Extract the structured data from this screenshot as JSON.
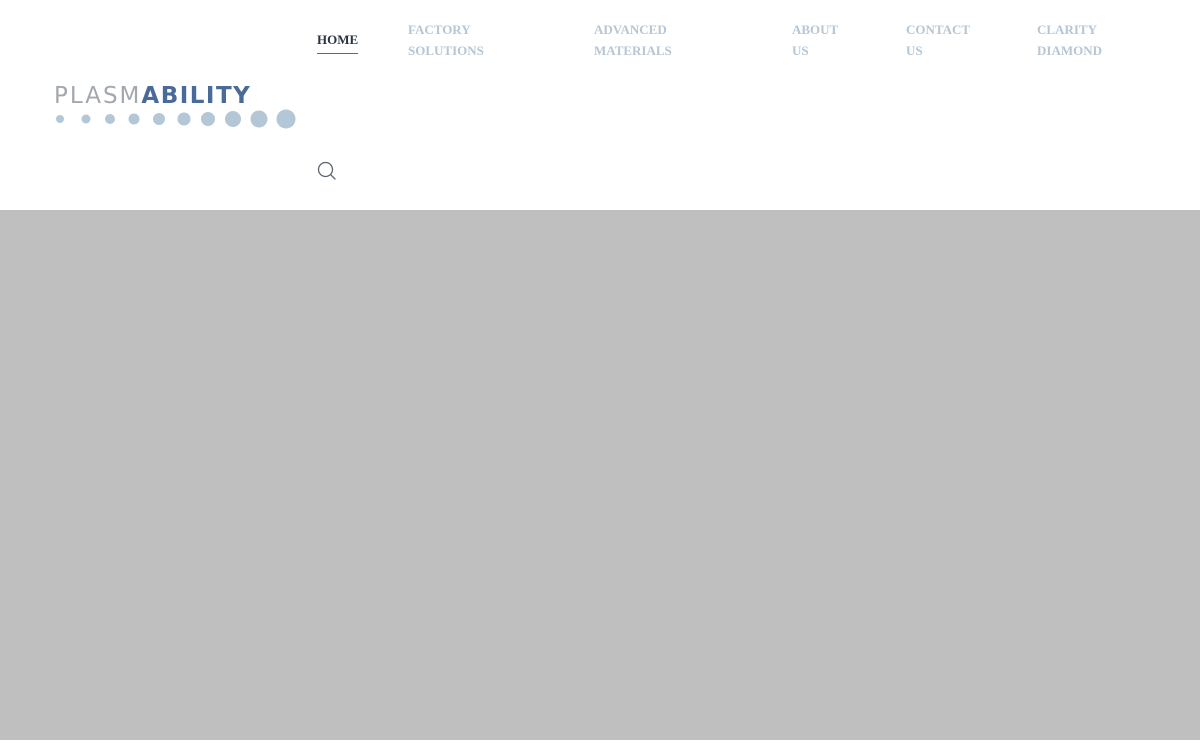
{
  "brand": {
    "name_light": "PLASM",
    "name_dark": "ABILITY",
    "color_light": "#a2a8ad",
    "color_dark": "#4a6a9a",
    "dot_color": "#b3c7d6"
  },
  "nav": {
    "items": [
      {
        "line1": "HOME",
        "line2": "",
        "active": true
      },
      {
        "line1": "FACTORY",
        "line2": "SOLUTIONS",
        "active": false
      },
      {
        "line1": "ADVANCED",
        "line2": "MATERIALS",
        "active": false
      },
      {
        "line1": "ABOUT",
        "line2": "US",
        "active": false
      },
      {
        "line1": "CONTACT",
        "line2": "US",
        "active": false
      },
      {
        "line1": "CLARITY",
        "line2": "DIAMOND",
        "active": false
      }
    ],
    "active_color": "#2a3441",
    "inactive_color": "#b7c6d3",
    "underline_color": "#3f6fa3"
  },
  "search": {
    "icon": "search-icon"
  },
  "hero": {
    "background": "#bfbfbf"
  }
}
